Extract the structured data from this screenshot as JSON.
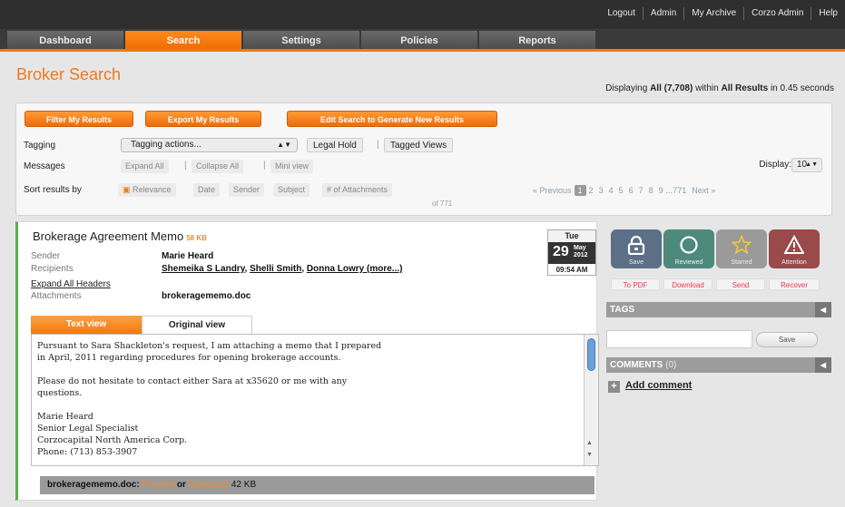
{
  "top_links": [
    "Logout",
    "Admin",
    "My Archive",
    "Corzo Admin",
    "Help"
  ],
  "nav_tabs": [
    "Dashboard",
    "Search",
    "Settings",
    "Policies",
    "Reports"
  ],
  "page_title": "Broker Search",
  "displaying": {
    "prefix": "Displaying",
    "scope": "All (7,708)",
    "within": "within",
    "results": "All Results",
    "suffix": "in 0.45 seconds"
  },
  "filter": {
    "filter_btn": "Filter My Results",
    "export_btn": "Export My Results",
    "edit_btn": "Edit Search to Generate New Results",
    "tagging_label": "Tagging",
    "tagging_select": "Tagging actions...",
    "legal_hold": "Legal Hold",
    "tagged_views": "Tagged Views",
    "messages_label": "Messages",
    "expand_all": "Expand All",
    "collapse_all": "Collapse All",
    "mini_view": "Mini view",
    "sort_label": "Sort results by",
    "sort_options": [
      "Relevance",
      "Date",
      "Sender",
      "Subject",
      "# of Attachments"
    ],
    "display_label": "Display:",
    "display_value": "10",
    "of_count": "of 771",
    "pager": {
      "prev": "« Previous",
      "current": "1",
      "pages": [
        "2",
        "3",
        "4",
        "5",
        "6",
        "7",
        "8",
        "9"
      ],
      "ellipsis": "...",
      "last": "771",
      "next": "Next »"
    }
  },
  "message": {
    "title": "Brokerage Agreement Memo",
    "size": "58 KB",
    "sender_label": "Sender",
    "sender": "Marie Heard",
    "recipients_label": "Recipients",
    "recipients": [
      "Shemeika S Landry",
      "Shelli Smith",
      "Donna Lowry (more...)"
    ],
    "expand_headers": "Expand All Headers",
    "attachments_label": "Attachments",
    "attachment": "brokeragememo.doc",
    "date": {
      "dow": "Tue",
      "day": "29",
      "month": "May",
      "year": "2012",
      "time": "09:54 AM"
    },
    "tab_text": "Text view",
    "tab_original": "Original view",
    "body": "Pursuant to Sara Shackleton's request, I am attaching a memo that I prepared\nin April, 2011 regarding procedures for opening brokerage accounts.\n\nPlease do not hesitate to contact either Sara at x35620 or me with any\nquestions.\n\nMarie Heard\nSenior Legal Specialist\nCorzocapital North America Corp.\nPhone: (713) 853-3907",
    "attach_bar": {
      "file": "brokeragememo.doc:",
      "preview": "Preview",
      "or": "or",
      "download": "Download",
      "size": "42 KB"
    }
  },
  "actions": {
    "buttons": [
      {
        "label": "Save",
        "color": "#5b6f86"
      },
      {
        "label": "Reviewed",
        "color": "#4d8a7c"
      },
      {
        "label": "Starred",
        "color": "#9a9a9a"
      },
      {
        "label": "Attention",
        "color": "#9a4a4a"
      }
    ],
    "links": [
      "To PDF",
      "Download",
      "Send",
      "Recover"
    ]
  },
  "tags": {
    "header": "TAGS",
    "save": "Save"
  },
  "comments": {
    "header": "COMMENTS",
    "count": "(0)",
    "add": "Add comment"
  },
  "colors": {
    "accent": "#f07a12",
    "green_bar": "#59b24a"
  }
}
